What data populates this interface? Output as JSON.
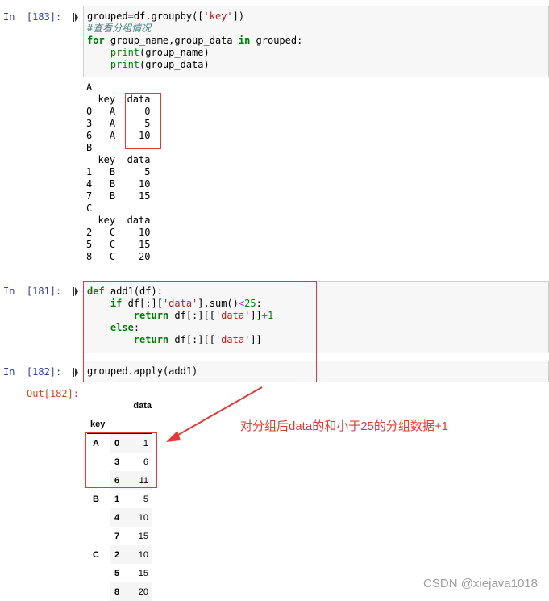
{
  "cells": [
    {
      "prompt": "In  [183]:",
      "code_lines": [
        [
          [
            "t",
            "grouped"
          ],
          [
            "op",
            "="
          ],
          [
            "t",
            "df.groupby(["
          ],
          [
            "st",
            "'key'"
          ],
          [
            "t",
            "])"
          ]
        ],
        [
          [
            "cm",
            "#查看分组情况"
          ]
        ],
        [
          [
            "kw",
            "for"
          ],
          [
            "t",
            " group_name,group_data "
          ],
          [
            "kw",
            "in"
          ],
          [
            "t",
            " grouped:"
          ]
        ],
        [
          [
            "t",
            "    "
          ],
          [
            "bi",
            "print"
          ],
          [
            "t",
            "(group_name)"
          ]
        ],
        [
          [
            "t",
            "    "
          ],
          [
            "bi",
            "print"
          ],
          [
            "t",
            "(group_data)"
          ]
        ]
      ],
      "output_lines": [
        "A",
        "  key  data",
        "0   A     0",
        "3   A     5",
        "6   A    10",
        "B",
        "  key  data",
        "1   B     5",
        "4   B    10",
        "7   B    15",
        "C",
        "  key  data",
        "2   C    10",
        "5   C    15",
        "8   C    20"
      ]
    },
    {
      "prompt": "In  [181]:",
      "code_lines": [
        [
          [
            "kw",
            "def"
          ],
          [
            "t",
            " add1(df):"
          ]
        ],
        [
          [
            "t",
            "    "
          ],
          [
            "kw",
            "if"
          ],
          [
            "t",
            " df[:]["
          ],
          [
            "st",
            "'data'"
          ],
          [
            "t",
            "].sum()"
          ],
          [
            "op",
            "<"
          ],
          [
            "num",
            "25"
          ],
          [
            "t",
            ":"
          ]
        ],
        [
          [
            "t",
            "        "
          ],
          [
            "kw",
            "return"
          ],
          [
            "t",
            " df[:][["
          ],
          [
            "st",
            "'data'"
          ],
          [
            "t",
            "]]"
          ],
          [
            "op",
            "+"
          ],
          [
            "num",
            "1"
          ]
        ],
        [
          [
            "t",
            "    "
          ],
          [
            "kw",
            "else"
          ],
          [
            "t",
            ":"
          ]
        ],
        [
          [
            "t",
            "        "
          ],
          [
            "kw",
            "return"
          ],
          [
            "t",
            " df[:][["
          ],
          [
            "st",
            "'data'"
          ],
          [
            "t",
            "]]"
          ]
        ]
      ]
    },
    {
      "prompt": "In  [182]:",
      "out_prompt": "Out[182]:",
      "code_lines": [
        [
          [
            "t",
            "grouped.apply(add1)"
          ]
        ]
      ]
    }
  ],
  "result_table": {
    "column_header": "data",
    "index_name": "key",
    "rows": [
      {
        "key": "A",
        "idx": "0",
        "data": "1"
      },
      {
        "key": "",
        "idx": "3",
        "data": "6"
      },
      {
        "key": "",
        "idx": "6",
        "data": "11"
      },
      {
        "key": "B",
        "idx": "1",
        "data": "5"
      },
      {
        "key": "",
        "idx": "4",
        "data": "10"
      },
      {
        "key": "",
        "idx": "7",
        "data": "15"
      },
      {
        "key": "C",
        "idx": "2",
        "data": "10"
      },
      {
        "key": "",
        "idx": "5",
        "data": "15"
      },
      {
        "key": "",
        "idx": "8",
        "data": "20"
      }
    ]
  },
  "annotation": "对分组后data的和小于25的分组数据+1",
  "watermark": "CSDN @xiejava1018",
  "colors": {
    "annotation_red": "#e53935",
    "prompt_in": "#303f9f",
    "prompt_out": "#d84315",
    "keyword": "#008000",
    "string": "#ba2121"
  }
}
